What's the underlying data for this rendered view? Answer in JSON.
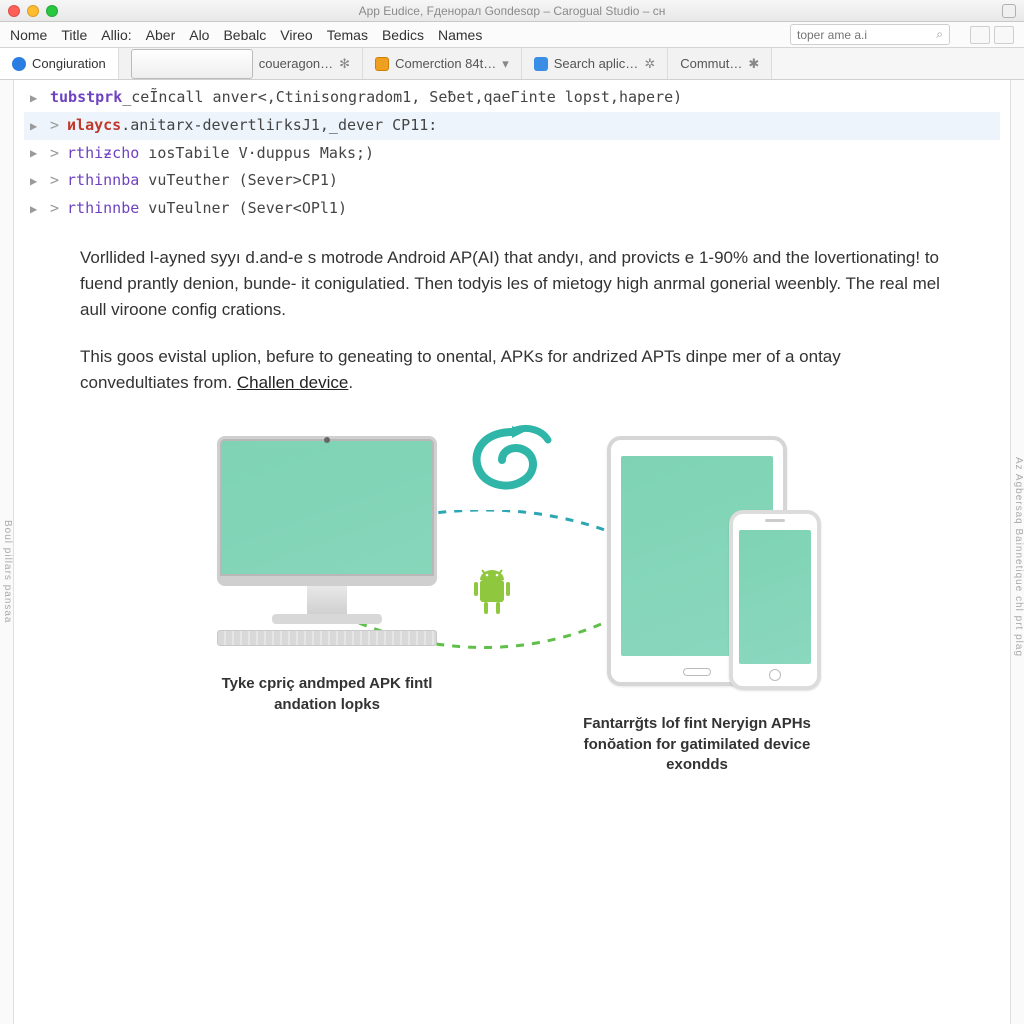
{
  "window": {
    "title": "App Eudice, Fденорал Gопdеsαр – Carogual Studio – cн"
  },
  "menu": [
    "Nome",
    "Title",
    "Allio:",
    "Aber",
    "Alo",
    "Bebalc",
    "Vireo",
    "Temas",
    "Bedics",
    "Names"
  ],
  "search": {
    "placeholder": "toper ame a.i"
  },
  "tabs": [
    {
      "label": "Congiuration",
      "icon": "globe-icon"
    },
    {
      "label": "coueragon…",
      "icon": "doc-icon",
      "extra": "✻"
    },
    {
      "label": "Comerction 84t…",
      "icon": "cube-icon",
      "dd": "▾"
    },
    {
      "label": "Search aplic…",
      "icon": "search-icon",
      "extra": "✲"
    },
    {
      "label": "Commut…",
      "extra": "✱"
    }
  ],
  "tree": [
    {
      "indent": 0,
      "kw": "tubstprk",
      "cls": "kw1",
      "rest": "_ceĨncall anver<,Ctinisongradom1, Seƀet,qaeГinte lopst,hapere)",
      "sel": false
    },
    {
      "indent": 1,
      "kw": "иlaycs",
      "cls": "kw2",
      "rest": ".anitarx-devertliгksJ1,_dever CP11:",
      "sel": true
    },
    {
      "indent": 1,
      "kw": "rthiƶcho",
      "cls": "kw3",
      "rest": " ıosTabile V·duppus Maks;)",
      "sel": false
    },
    {
      "indent": 1,
      "kw": "rthinnba",
      "cls": "kw3",
      "rest": " vuTeuther (Sever>CP1)",
      "sel": false
    },
    {
      "indent": 1,
      "kw": "rthinnbe",
      "cls": "kw3",
      "rest": " vuTeulner (Sever<OPl1)",
      "sel": false
    }
  ],
  "doc": {
    "p1": "Vorllided l-ayned syyı d.and-e s motrode Android AP(AI) that andyı, and provicts e 1-90% and the lovertionating! to fuend prantly denion, bunde- it conigulatied.  Then todyis les of mietogy high anrmal gonerial weenbly.  The real mel aull viroone config crations.",
    "p2a": "This goos evistal uplion, befure to geneating to onental, APKs for andrized APTs dinpe mer of a ontay convedultiates from. ",
    "link": "Challen device",
    "p2b": "."
  },
  "captions": {
    "left": "Tyke cpriç andmped APK fintl andation lopks",
    "right": "Fantarrğts lof fint Neryign APHs fonŏation for gatimilated device exondds"
  },
  "sidebars": {
    "left": "Boul pillars pansaa",
    "right": "Az    Agbersaq    Bainnetique   chl prt plag"
  }
}
